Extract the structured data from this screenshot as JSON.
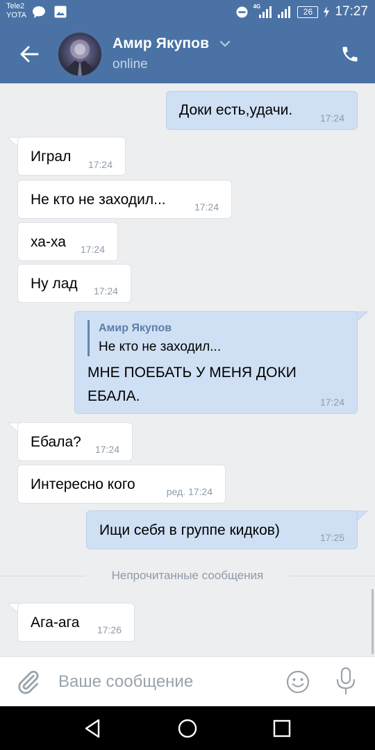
{
  "status_bar": {
    "carrier_line1": "Tele2",
    "carrier_line2": "YOTA",
    "network_type": "4G",
    "battery": "26",
    "time": "17:27"
  },
  "header": {
    "contact_name": "Амир Якупов",
    "status": "online"
  },
  "messages": [
    {
      "dir": "out",
      "text": "Доки есть,удачи.",
      "time": "17:24"
    },
    {
      "dir": "in",
      "text": "Играл",
      "time": "17:24"
    },
    {
      "dir": "in",
      "text": "Не кто не заходил...",
      "time": "17:24"
    },
    {
      "dir": "in",
      "text": "ха-ха",
      "time": "17:24"
    },
    {
      "dir": "in",
      "text": "Ну лад",
      "time": "17:24"
    },
    {
      "dir": "out",
      "reply_author": "Амир Якупов",
      "reply_text": "Не кто не заходил...",
      "text_line1": "МНЕ ПОЕБАТЬ У МЕНЯ ДОКИ",
      "text_line2": "ЕБАЛА.",
      "time": "17:24"
    },
    {
      "dir": "in",
      "text": "Ебала?",
      "time": "17:24"
    },
    {
      "dir": "in",
      "text": "Интересно кого",
      "time": "ред. 17:24"
    },
    {
      "dir": "out",
      "text": "Ищи себя в группе кидков)",
      "time": "17:25"
    },
    {
      "dir": "in",
      "text": "Ага-ага",
      "time": "17:26"
    }
  ],
  "unread_divider": "Непрочитанные сообщения",
  "composer": {
    "placeholder": "Ваше сообщение"
  },
  "colors": {
    "header": "#4a72a4",
    "incoming_bubble": "#ffffff",
    "outgoing_bubble": "#cfe0f5",
    "background": "#edeef0",
    "timestamp": "#8e9aa8",
    "icon_gray": "#9aa3ad"
  },
  "icons": {
    "status_bar": [
      "chat-bubble-icon",
      "image-icon",
      "do-not-disturb-icon",
      "signal-4g-icon",
      "signal-icon",
      "battery-icon",
      "charging-icon"
    ],
    "header": [
      "back-arrow-icon",
      "chevron-down-icon",
      "phone-icon"
    ],
    "composer": [
      "paperclip-icon",
      "emoji-icon",
      "microphone-icon"
    ],
    "navbar": [
      "nav-back-icon",
      "nav-home-icon",
      "nav-recents-icon"
    ]
  }
}
